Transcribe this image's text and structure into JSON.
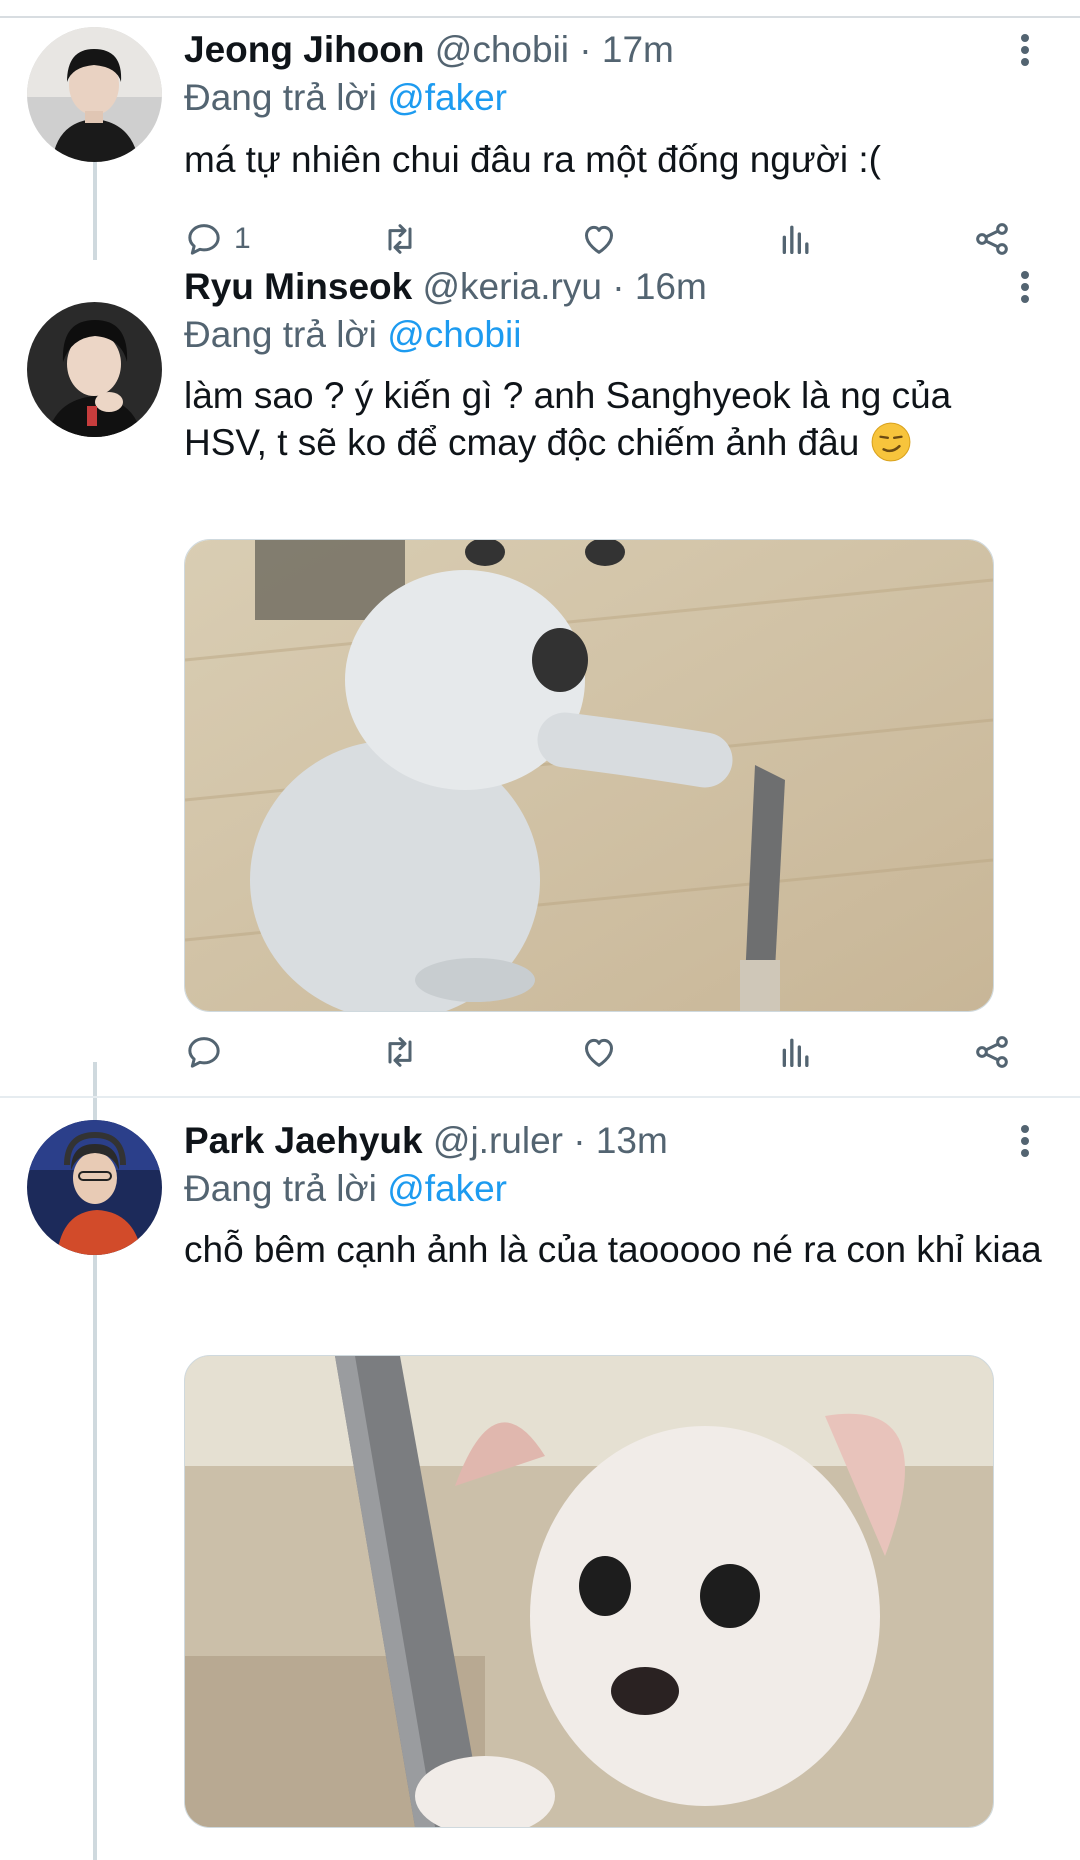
{
  "tweets": [
    {
      "name": "Jeong Jihoon",
      "handle": "@chobii",
      "sep": "·",
      "time": "17m",
      "replying_prefix": "Đang trả lời",
      "replying_to": "@faker",
      "text": "má tự nhiên chui đâu ra một đống người :(",
      "reply_count": "1"
    },
    {
      "name": "Ryu Minseok",
      "handle": "@keria.ryu",
      "sep": "·",
      "time": "16m",
      "replying_prefix": "Đang trả lời",
      "replying_to": "@chobii",
      "text_line1": "làm sao ? ý kiến gì ? anh Sanghyeok là ng của",
      "text_line2": "HSV, t sẽ ko để cmay độc chiếm ảnh đâu",
      "emoji": "smirking-face",
      "reply_count": ""
    },
    {
      "name": "Park Jaehyuk",
      "handle": "@j.ruler",
      "sep": "·",
      "time": "13m",
      "replying_prefix": "Đang trả lời",
      "replying_to": "@faker",
      "text": "chỗ bêm cạnh ảnh là của taooooo né ra con khỉ kiaa"
    }
  ],
  "icons": {
    "reply": "reply-icon",
    "retweet": "retweet-icon",
    "like": "heart-icon",
    "analytics": "analytics-icon",
    "share": "share-icon",
    "more": "more-vertical-icon"
  },
  "colors": {
    "text": "#0f1419",
    "secondary": "#536471",
    "accent": "#1d9bf0",
    "divider": "#e6ecf0",
    "thread_line": "#cfd9de"
  }
}
